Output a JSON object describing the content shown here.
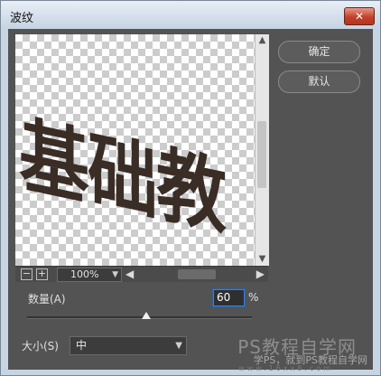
{
  "window": {
    "title": "波纹",
    "close_glyph": "✕"
  },
  "preview": {
    "sample_text": "基础教",
    "zoom": {
      "value": "100%",
      "minus": "−",
      "plus": "+"
    }
  },
  "buttons": {
    "ok": "确定",
    "default": "默认"
  },
  "amount": {
    "label": "数量(A)",
    "value": "60",
    "unit": "%",
    "level_fraction": 0.53
  },
  "size": {
    "label": "大小(S)",
    "value": "中"
  },
  "watermark": {
    "line1": "PS教程自学网",
    "line2": "学PS，就到PS教程自学网",
    "line3": "www.16xx8.com"
  },
  "icons": {
    "close": "close-icon",
    "zoom_minus": "minus-icon",
    "zoom_plus": "plus-icon",
    "zoom_dropdown": "chevron-down-icon",
    "scroll_up": "arrow-up-icon",
    "scroll_down": "arrow-down-icon",
    "scroll_left": "arrow-left-icon",
    "scroll_right": "arrow-right-icon",
    "size_dropdown": "chevron-down-icon"
  },
  "colors": {
    "accent": "#3c82d6",
    "panel": "#535353",
    "close_button": "#c4402a"
  }
}
